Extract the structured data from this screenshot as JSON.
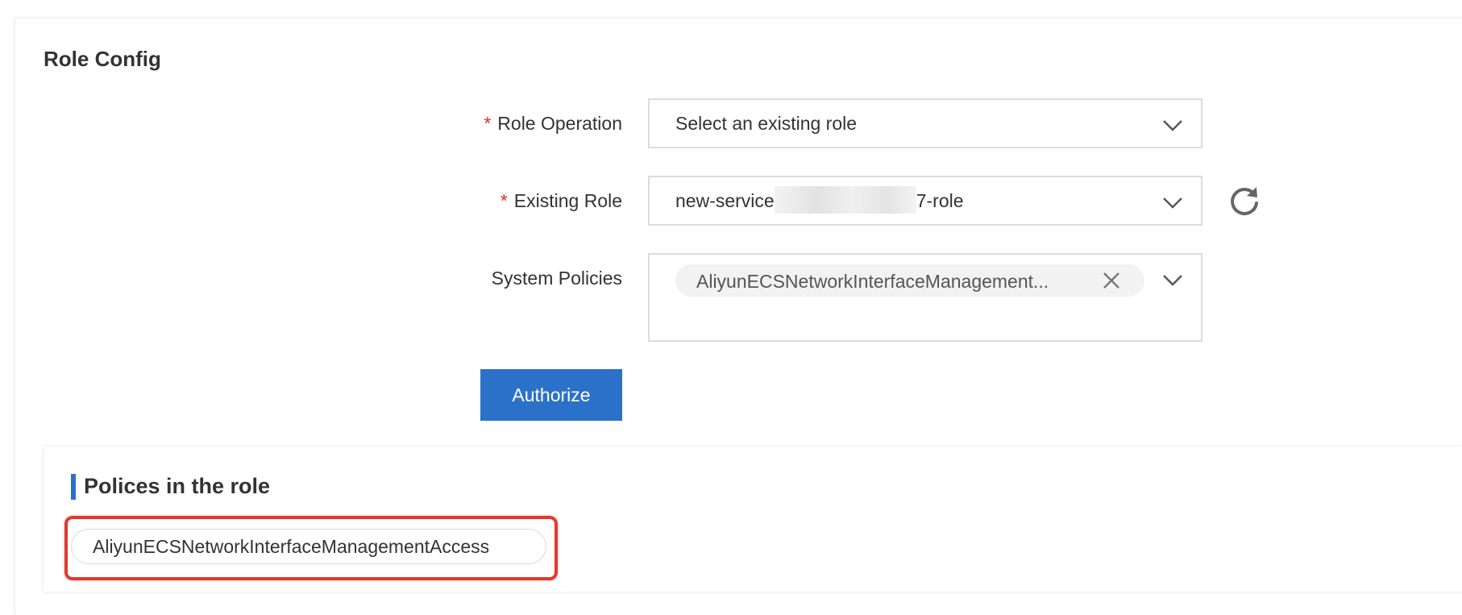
{
  "section": {
    "title": "Role Config"
  },
  "form": {
    "role_operation": {
      "label": "Role Operation",
      "required": "*",
      "value": "Select an existing role"
    },
    "existing_role": {
      "label": "Existing Role",
      "required": "*",
      "value_prefix": "new-service",
      "value_suffix": "7-role"
    },
    "system_policies": {
      "label": "System Policies",
      "tag": "AliyunECSNetworkInterfaceManagement..."
    },
    "authorize_label": "Authorize"
  },
  "policies_panel": {
    "title": "Polices in the role",
    "items": [
      "AliyunECSNetworkInterfaceManagementAccess"
    ]
  },
  "colors": {
    "accent": "#2b71c9",
    "required": "#d93026",
    "highlight": "#e03a2f"
  },
  "icons": {
    "dropdown": "chevron-down-icon",
    "refresh": "refresh-icon",
    "remove": "close-icon"
  }
}
